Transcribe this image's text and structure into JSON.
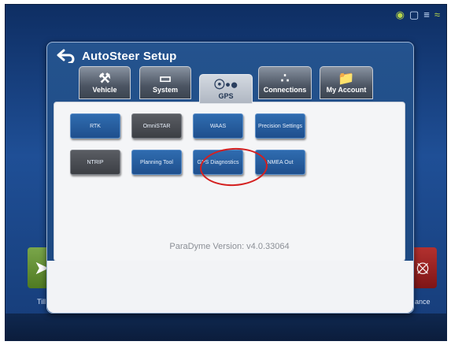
{
  "dialog": {
    "title": "AutoSteer Setup"
  },
  "tabs": [
    {
      "label": "Vehicle",
      "icon": "tractor-icon",
      "active": false
    },
    {
      "label": "System",
      "icon": "monitor-icon",
      "active": false
    },
    {
      "label": "GPS",
      "icon": "satellite-icon",
      "active": true
    },
    {
      "label": "Connections",
      "icon": "network-icon",
      "active": false
    },
    {
      "label": "My Account",
      "icon": "folder-icon",
      "active": false
    }
  ],
  "gps_buttons": [
    {
      "label": "RTK",
      "style": "blue"
    },
    {
      "label": "OmniSTAR",
      "style": "gray"
    },
    {
      "label": "WAAS",
      "style": "blue"
    },
    {
      "label": "Precision Settings",
      "style": "blue"
    },
    {
      "label": "NTRIP",
      "style": "gray"
    },
    {
      "label": "Planning Tool",
      "style": "blue"
    },
    {
      "label": "GPS Diagnostics",
      "style": "blue"
    },
    {
      "label": "NMEA Out",
      "style": "blue"
    }
  ],
  "version_text": "ParaDyme Version: v4.0.33064",
  "side_labels": {
    "left": "Till",
    "right": "ance"
  },
  "colors": {
    "highlight_ring": "#d42020",
    "button_blue": "#2f6cb0",
    "button_gray": "#4a4d52"
  }
}
